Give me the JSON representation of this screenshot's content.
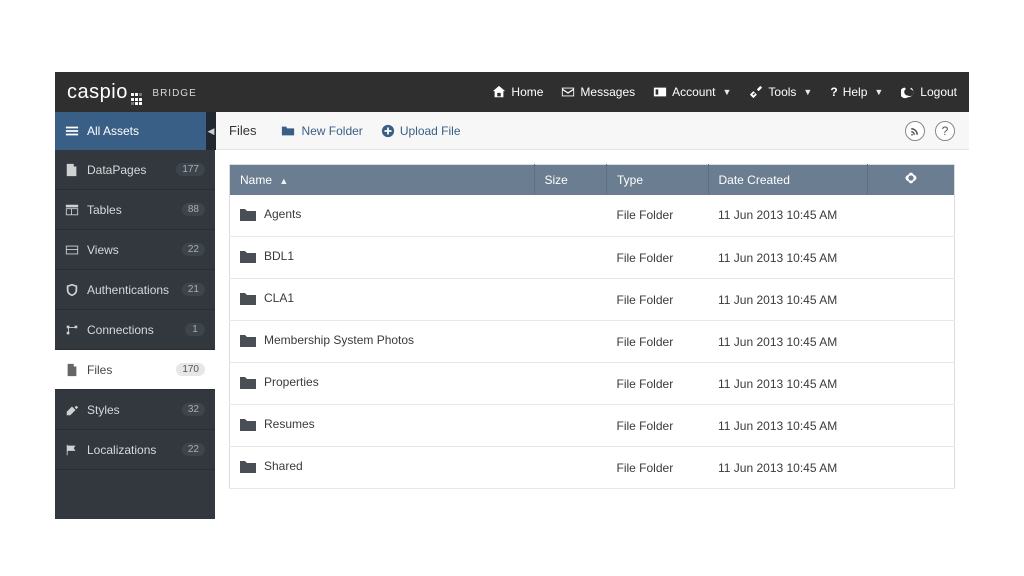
{
  "brand": {
    "name": "caspio",
    "sub": "BRIDGE"
  },
  "topnav": {
    "home": "Home",
    "messages": "Messages",
    "account": "Account",
    "tools": "Tools",
    "help": "Help",
    "logout": "Logout"
  },
  "sidebar": {
    "title": "All Assets",
    "items": [
      {
        "key": "datapages",
        "label": "DataPages",
        "count": "177"
      },
      {
        "key": "tables",
        "label": "Tables",
        "count": "88"
      },
      {
        "key": "views",
        "label": "Views",
        "count": "22"
      },
      {
        "key": "authentications",
        "label": "Authentications",
        "count": "21"
      },
      {
        "key": "connections",
        "label": "Connections",
        "count": "1"
      },
      {
        "key": "files",
        "label": "Files",
        "count": "170"
      },
      {
        "key": "styles",
        "label": "Styles",
        "count": "32"
      },
      {
        "key": "localizations",
        "label": "Localizations",
        "count": "22"
      }
    ],
    "active_key": "files"
  },
  "toolbar": {
    "title": "Files",
    "new_folder": "New Folder",
    "upload_file": "Upload File"
  },
  "columns": {
    "name": "Name",
    "size": "Size",
    "type": "Type",
    "date": "Date Created"
  },
  "rows": [
    {
      "name": "Agents",
      "size": "",
      "type": "File Folder",
      "date": "11 Jun 2013 10:45 AM"
    },
    {
      "name": "BDL1",
      "size": "",
      "type": "File Folder",
      "date": "11 Jun 2013 10:45 AM"
    },
    {
      "name": "CLA1",
      "size": "",
      "type": "File Folder",
      "date": "11 Jun 2013 10:45 AM"
    },
    {
      "name": "Membership System Photos",
      "size": "",
      "type": "File Folder",
      "date": "11 Jun 2013 10:45 AM"
    },
    {
      "name": "Properties",
      "size": "",
      "type": "File Folder",
      "date": "11 Jun 2013 10:45 AM"
    },
    {
      "name": "Resumes",
      "size": "",
      "type": "File Folder",
      "date": "11 Jun 2013 10:45 AM"
    },
    {
      "name": "Shared",
      "size": "",
      "type": "File Folder",
      "date": "11 Jun 2013 10:45 AM"
    }
  ]
}
